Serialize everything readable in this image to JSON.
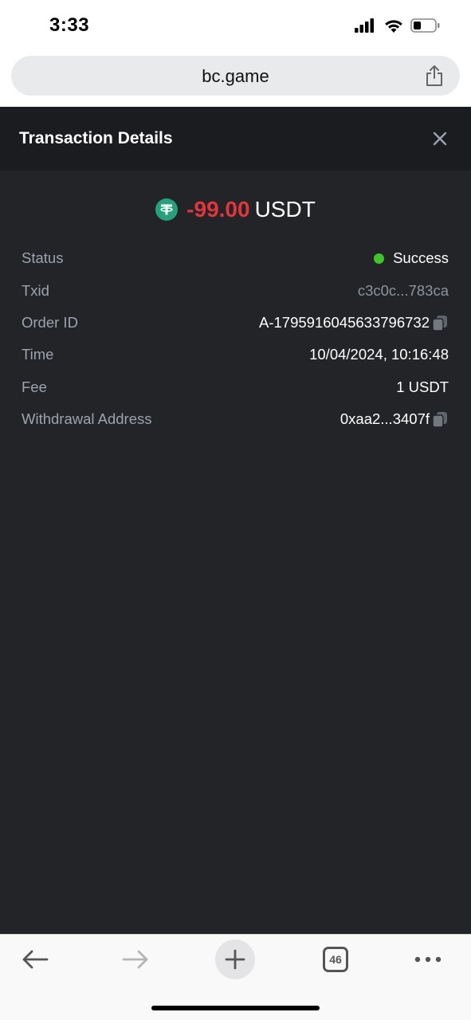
{
  "status_bar": {
    "time": "3:33"
  },
  "browser": {
    "url": "bc.game"
  },
  "modal": {
    "title": "Transaction Details",
    "amount": "-99.00",
    "currency": "USDT",
    "rows": [
      {
        "label": "Status",
        "value": "Success"
      },
      {
        "label": "Txid",
        "value": "c3c0c...783ca"
      },
      {
        "label": "Order ID",
        "value": "A-1795916045633796732"
      },
      {
        "label": "Time",
        "value": "10/04/2024, 10:16:48"
      },
      {
        "label": "Fee",
        "value": "1 USDT"
      },
      {
        "label": "Withdrawal Address",
        "value": "0xaa2...3407f"
      }
    ]
  },
  "toolbar": {
    "tab_count": "46"
  },
  "colors": {
    "amount_negative": "#e0363c",
    "success_dot": "#3fc42c",
    "modal_bg": "#232427",
    "header_bg": "#1b1c1f",
    "tether_green": "#26a17b"
  }
}
